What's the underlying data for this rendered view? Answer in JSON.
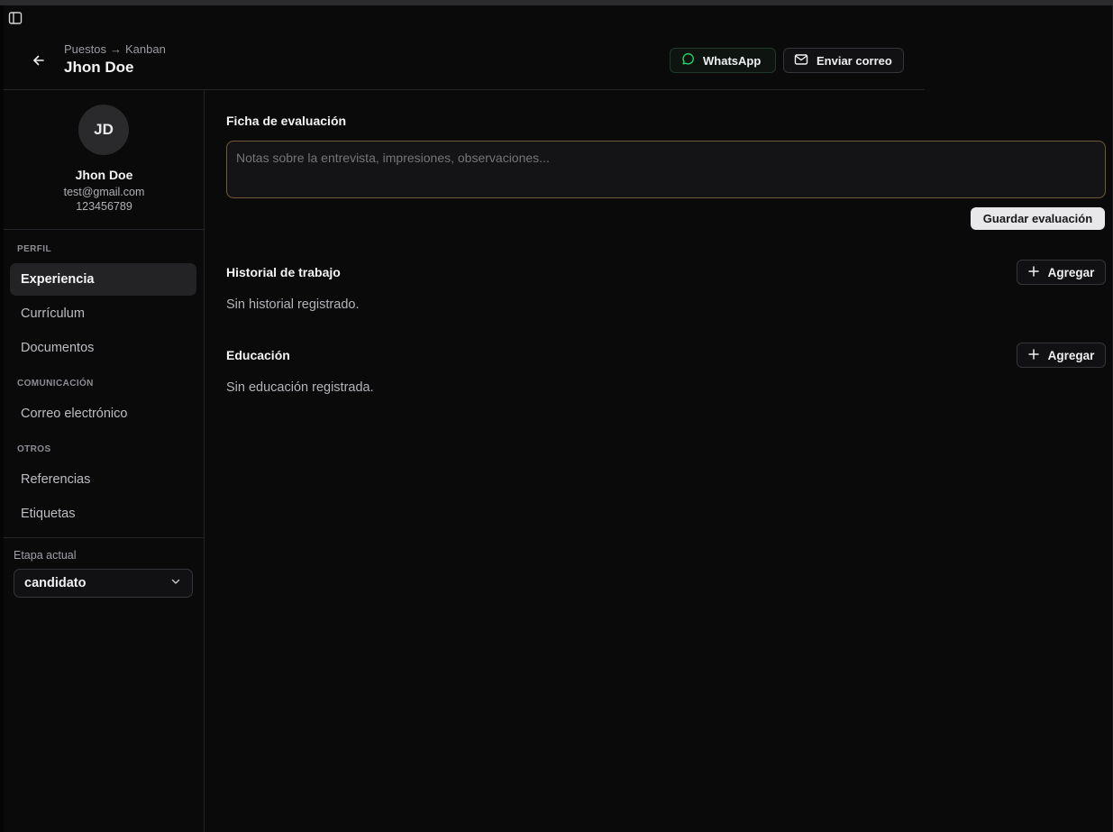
{
  "header": {
    "breadcrumb_from": "Puestos",
    "breadcrumb_arrow": "→",
    "breadcrumb_to": "Kanban",
    "candidate_name": "Jhon Doe",
    "whatsapp_label": "WhatsApp",
    "email_label": "Enviar correo"
  },
  "profile": {
    "initials": "JD",
    "name": "Jhon Doe",
    "email": "test@gmail.com",
    "phone": "123456789"
  },
  "nav": {
    "sections": [
      {
        "label": "PERFIL",
        "items": [
          "Experiencia",
          "Currículum",
          "Documentos"
        ]
      },
      {
        "label": "COMUNICACIÓN",
        "items": [
          "Correo electrónico"
        ]
      },
      {
        "label": "OTROS",
        "items": [
          "Referencias",
          "Etiquetas"
        ]
      }
    ],
    "active": "Experiencia"
  },
  "stage": {
    "label": "Etapa actual",
    "value": "candidato"
  },
  "main": {
    "evaluation_title": "Ficha de evaluación",
    "evaluation_placeholder": "Notas sobre la entrevista, impresiones, observaciones...",
    "save_label": "Guardar evaluación",
    "work_history_title": "Historial de trabajo",
    "work_history_empty": "Sin historial registrado.",
    "education_title": "Educación",
    "education_empty": "Sin educación registrada.",
    "add_label": "Agregar"
  },
  "colors": {
    "background": "#0a0a0b",
    "whatsapp_green": "#25d366",
    "focus_border": "#6d5a3b"
  }
}
